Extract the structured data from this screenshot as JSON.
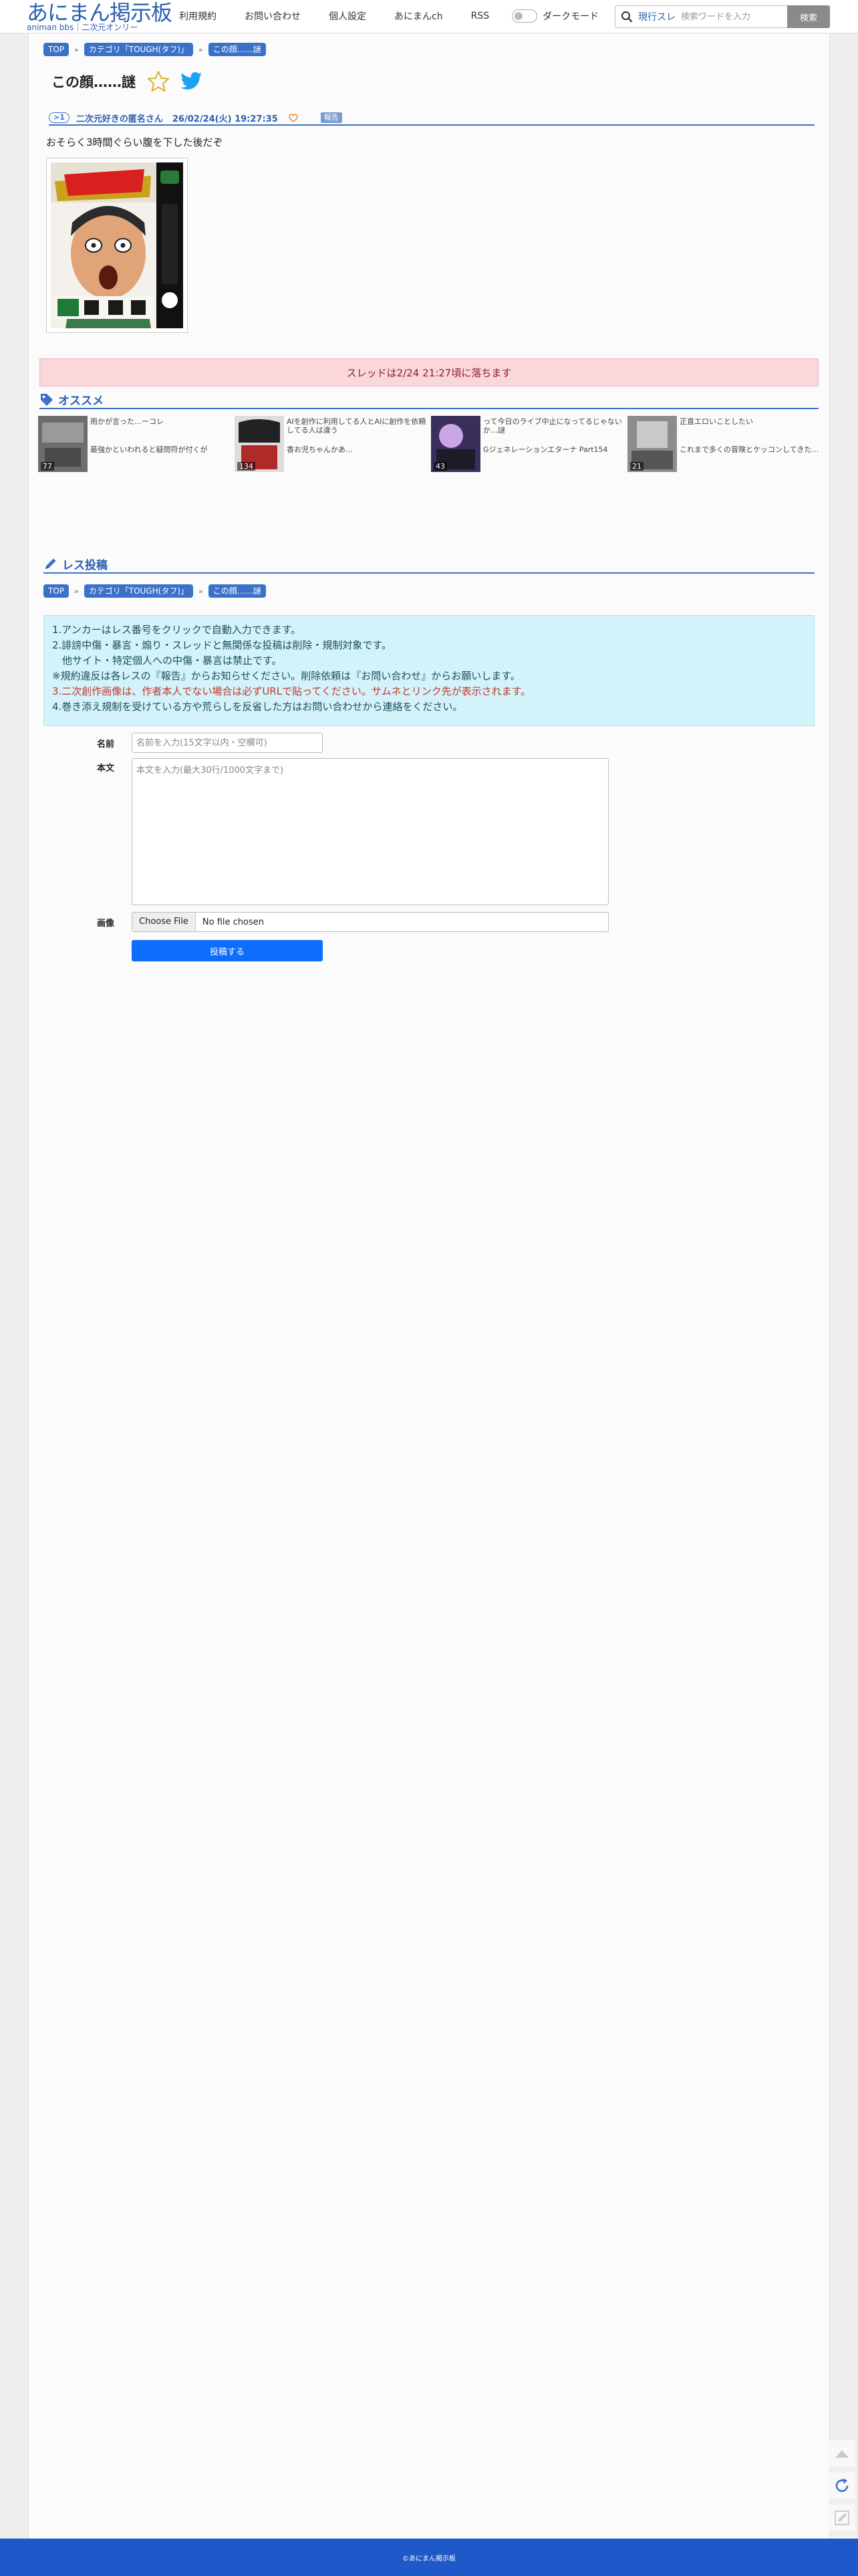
{
  "header": {
    "logo_main": "あにまん掲示板",
    "logo_sub": "animan bbs｜二次元オンリー",
    "nav": [
      "利用規約",
      "お問い合わせ",
      "個人設定",
      "あにまんch",
      "RSS"
    ],
    "dark_mode_label": "ダークモード",
    "search_scope": "現行スレ",
    "search_placeholder": "検索ワードを入力",
    "search_button": "検索"
  },
  "breadcrumb": [
    "TOP",
    "カテゴリ「TOUGH(タフ)」",
    "この顔……謎"
  ],
  "thread": {
    "title": "この顔……謎",
    "post": {
      "number": ">1",
      "name": "二次元好きの匿名さん",
      "date": "26/02/24(火) 19:27:35",
      "report": "報告",
      "body": "おそらく3時間ぐらい腹を下した後だぞ"
    },
    "cover": {
      "publisher": "SHUEISHA",
      "number": "11",
      "label": "YOUNG JUMP COMICS",
      "author": "猿渡哲也"
    },
    "expire_notice": "スレッドは2/24 21:27頃に落ちます"
  },
  "recommend": {
    "heading": "オススメ",
    "items": [
      {
        "title_top": "雨かが言った…ーコレ",
        "title_bottom": "最強かといわれると疑問符が付くが",
        "count": "77"
      },
      {
        "title_top": "AIを創作に利用してる人とAIに創作を依頼してる人は違う",
        "title_bottom": "香お児ちゃんかあ…",
        "count": "134"
      },
      {
        "title_top": "って今日のライブ中止になってるじゃないか…謎",
        "title_bottom": "Gジェネレーションエターナ Part154",
        "count": "43"
      },
      {
        "title_top": "正直エロいことしたい",
        "title_bottom": "これまで多くの冒険とケッコンしてきた…",
        "count": "21"
      }
    ]
  },
  "form": {
    "heading": "レス投稿",
    "rules": [
      "1.アンカーはレス番号をクリックで自動入力できます。",
      "2.誹謗中傷・暴言・煽り・スレッドと無関係な投稿は削除・規制対象です。",
      "　他サイト・特定個人への中傷・暴言は禁止です。",
      "※規約違反は各レスの『報告』からお知らせください。削除依頼は『お問い合わせ』からお願いします。",
      "3.二次創作画像は、作者本人でない場合は必ずURLで貼ってください。サムネとリンク先が表示されます。",
      "4.巻き添え規制を受けている方や荒らしを反省した方はお問い合わせから連絡をください。"
    ],
    "name_label": "名前",
    "name_placeholder": "名前を入力(15文字以内・空欄可)",
    "body_label": "本文",
    "body_placeholder": "本文を入力(最大30行/1000文字まで)",
    "image_label": "画像",
    "file_button": "Choose File",
    "file_status": "No file chosen",
    "submit": "投稿する"
  },
  "footer": {
    "copyright": "©あにまん掲示板"
  },
  "colors": {
    "accent": "#3a72c9",
    "footer": "#1f58c8",
    "alert_bg": "#f9d7da",
    "info_bg": "#d3f2f9",
    "submit": "#0d6efd"
  }
}
